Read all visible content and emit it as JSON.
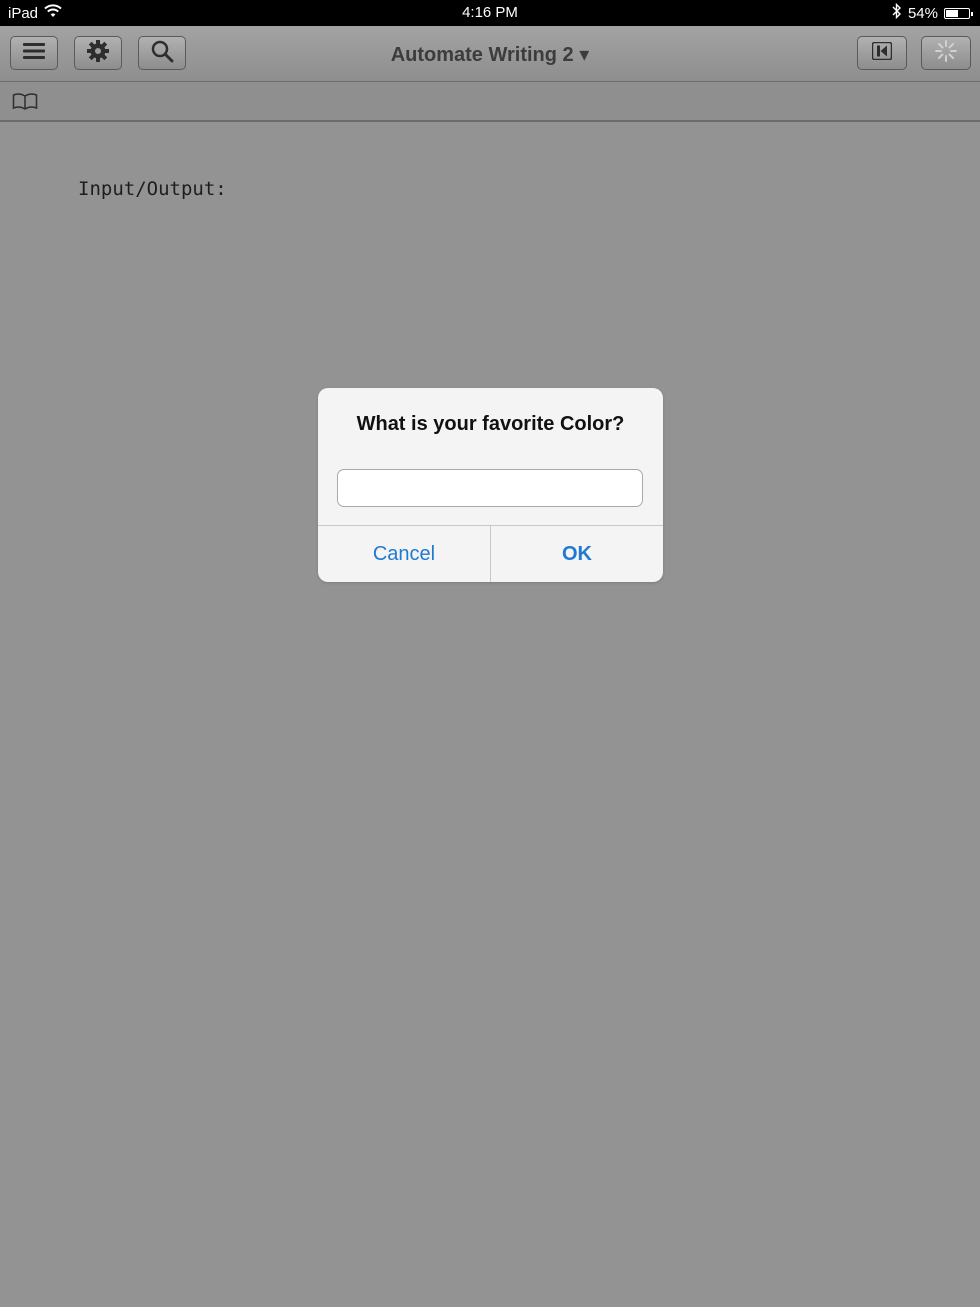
{
  "status_bar": {
    "device": "iPad",
    "time": "4:16 PM",
    "battery": "54%",
    "battery_level": 0.54
  },
  "toolbar": {
    "title": "Automate Writing 2 ▾",
    "icons": {
      "menu": "hamburger-menu-icon",
      "settings": "gear-icon",
      "search": "search-icon",
      "first": "skip-to-start-icon",
      "activity": "activity-spinner-icon"
    }
  },
  "subbar": {
    "icon": "book-icon"
  },
  "content": {
    "label": "Input/Output:"
  },
  "dialog": {
    "title": "What is your favorite Color?",
    "input_value": "",
    "cancel_label": "Cancel",
    "ok_label": "OK"
  },
  "colors": {
    "accent": "#1f7ad1",
    "background": "#939393"
  }
}
